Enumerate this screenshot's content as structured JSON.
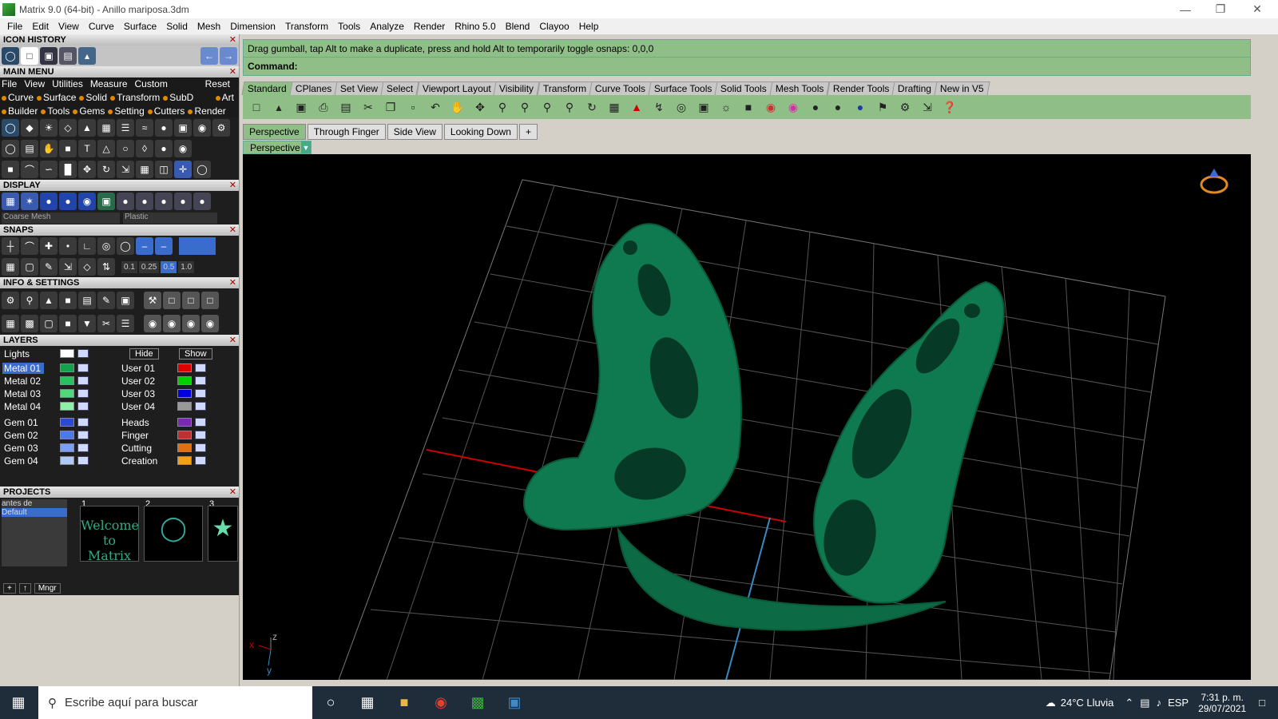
{
  "window": {
    "title": "Matrix 9.0 (64-bit) - Anillo mariposa.3dm"
  },
  "menubar": [
    "File",
    "Edit",
    "View",
    "Curve",
    "Surface",
    "Solid",
    "Mesh",
    "Dimension",
    "Transform",
    "Tools",
    "Analyze",
    "Render",
    "Rhino 5.0",
    "Blend",
    "Clayoo",
    "Help"
  ],
  "left": {
    "icon_history": "ICON HISTORY",
    "main_menu": "MAIN MENU",
    "main_menu_items": [
      "File",
      "View",
      "Utilities",
      "Measure",
      "Custom"
    ],
    "reset": "Reset",
    "cat_row1": [
      "Curve",
      "Surface",
      "Solid",
      "Transform",
      "SubD",
      "Art"
    ],
    "cat_row2": [
      "Builder",
      "Tools",
      "Gems",
      "Setting",
      "Cutters",
      "Render"
    ],
    "display": "DISPLAY",
    "display_mesh": "Coarse Mesh",
    "display_material": "Plastic",
    "snaps": "SNAPS",
    "snap_values": [
      "0.1",
      "0.25",
      "0.5",
      "1.0"
    ],
    "info": "INFO & SETTINGS",
    "layers": "LAYERS",
    "lights": "Lights",
    "hide": "Hide",
    "show": "Show",
    "layers_left": [
      "Metal 01",
      "Metal 02",
      "Metal 03",
      "Metal 04",
      "Gem 01",
      "Gem 02",
      "Gem 03",
      "Gem 04"
    ],
    "layers_right": [
      "User 01",
      "User 02",
      "User 03",
      "User 04",
      "Heads",
      "Finger",
      "Cutting",
      "Creation"
    ],
    "projects": "PROJECTS",
    "proj_list": [
      "antes de",
      "Default"
    ],
    "proj_nums": [
      "1",
      "2",
      "3"
    ],
    "welcome": "Welcome to Matrix",
    "mngr": "Mngr"
  },
  "command": {
    "prompt": "Drag gumball, tap Alt to make a duplicate, press and hold Alt to temporarily toggle osnaps: 0,0,0",
    "label": "Command:"
  },
  "tabs": [
    "Standard",
    "CPlanes",
    "Set View",
    "Select",
    "Viewport Layout",
    "Visibility",
    "Transform",
    "Curve Tools",
    "Surface Tools",
    "Solid Tools",
    "Mesh Tools",
    "Render Tools",
    "Drafting",
    "New in V5"
  ],
  "viewport_tabs": [
    "Perspective",
    "Through Finger",
    "Side View",
    "Looking Down",
    "+"
  ],
  "viewport_label": "Perspective",
  "axes": {
    "x": "x",
    "y": "y",
    "z": "z"
  },
  "taskbar": {
    "search": "Escribe aquí para buscar",
    "weather": "24°C  Lluvia",
    "lang": "ESP",
    "time": "7:31 p. m.",
    "date": "29/07/2021"
  },
  "colors": {
    "accent_green": "#8fbf86",
    "model_green": "#0f7a4f"
  }
}
